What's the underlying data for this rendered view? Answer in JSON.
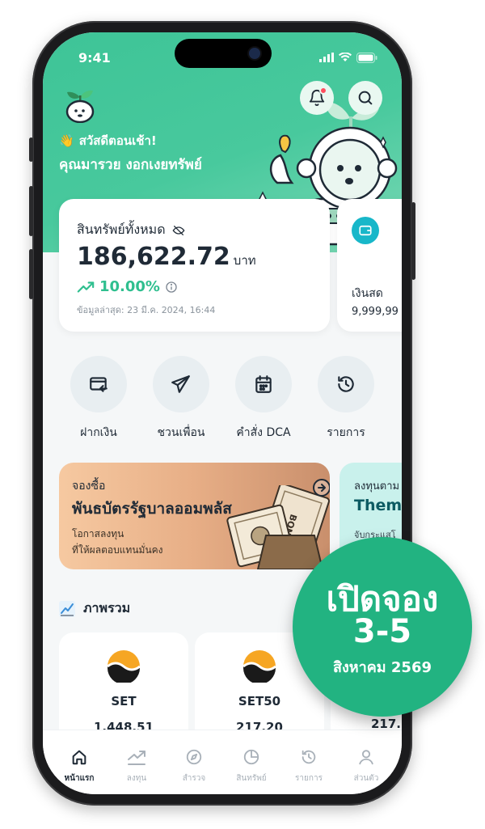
{
  "status": {
    "time": "9:41"
  },
  "header": {
    "greeting": "สวัสดีตอนเช้า!",
    "user_name": "คุณมารวย งอกเงยทรัพย์",
    "wave_emoji": "👋",
    "notification_unread": true
  },
  "balance": {
    "label": "สินทรัพย์ทั้งหมด",
    "amount": "186,622.72",
    "unit": "บาท",
    "change": "10.00%",
    "updated": "ข้อมูลล่าสุด: 23 มี.ค. 2024, 16:44"
  },
  "cash": {
    "label": "เงินสด",
    "amount": "9,999,99"
  },
  "quick_actions": [
    {
      "label": "ฝากเงิน",
      "icon": "deposit-icon"
    },
    {
      "label": "ชวนเพื่อน",
      "icon": "send-icon"
    },
    {
      "label": "คำสั่ง DCA",
      "icon": "calendar-icon"
    },
    {
      "label": "รายการ",
      "icon": "history-icon"
    }
  ],
  "promo": {
    "kicker": "จองซื้อ",
    "title": "พันธบัตรรัฐบาลออมพลัส",
    "sub_line1": "โอกาสลงทุน",
    "sub_line2": "ที่ให้ผลตอบแทนมั่นคง",
    "bond_label": "BOND"
  },
  "promo2": {
    "kicker": "ลงทุนตาม",
    "title": "Thema",
    "sub": "จับกระแสโ"
  },
  "overview": {
    "title": "ภาพรวม",
    "indices": [
      {
        "name": "SET",
        "value": "1,448.51"
      },
      {
        "name": "SET50",
        "value": "217.20"
      },
      {
        "name": "",
        "value": "217."
      }
    ]
  },
  "nav": [
    {
      "label": "หน้าแรก",
      "active": true
    },
    {
      "label": "ลงทุน",
      "active": false
    },
    {
      "label": "สำรวจ",
      "active": false
    },
    {
      "label": "สินทรัพย์",
      "active": false
    },
    {
      "label": "รายการ",
      "active": false
    },
    {
      "label": "ส่วนตัว",
      "active": false
    }
  ],
  "badge": {
    "line1": "เปิดจอง",
    "line2": "3-5",
    "line3": "สิงหาคม 2569"
  },
  "colors": {
    "brand": "#3ec497",
    "accent": "#2fbf8f",
    "badge": "#22b381",
    "notif": "#ff4d5e"
  }
}
